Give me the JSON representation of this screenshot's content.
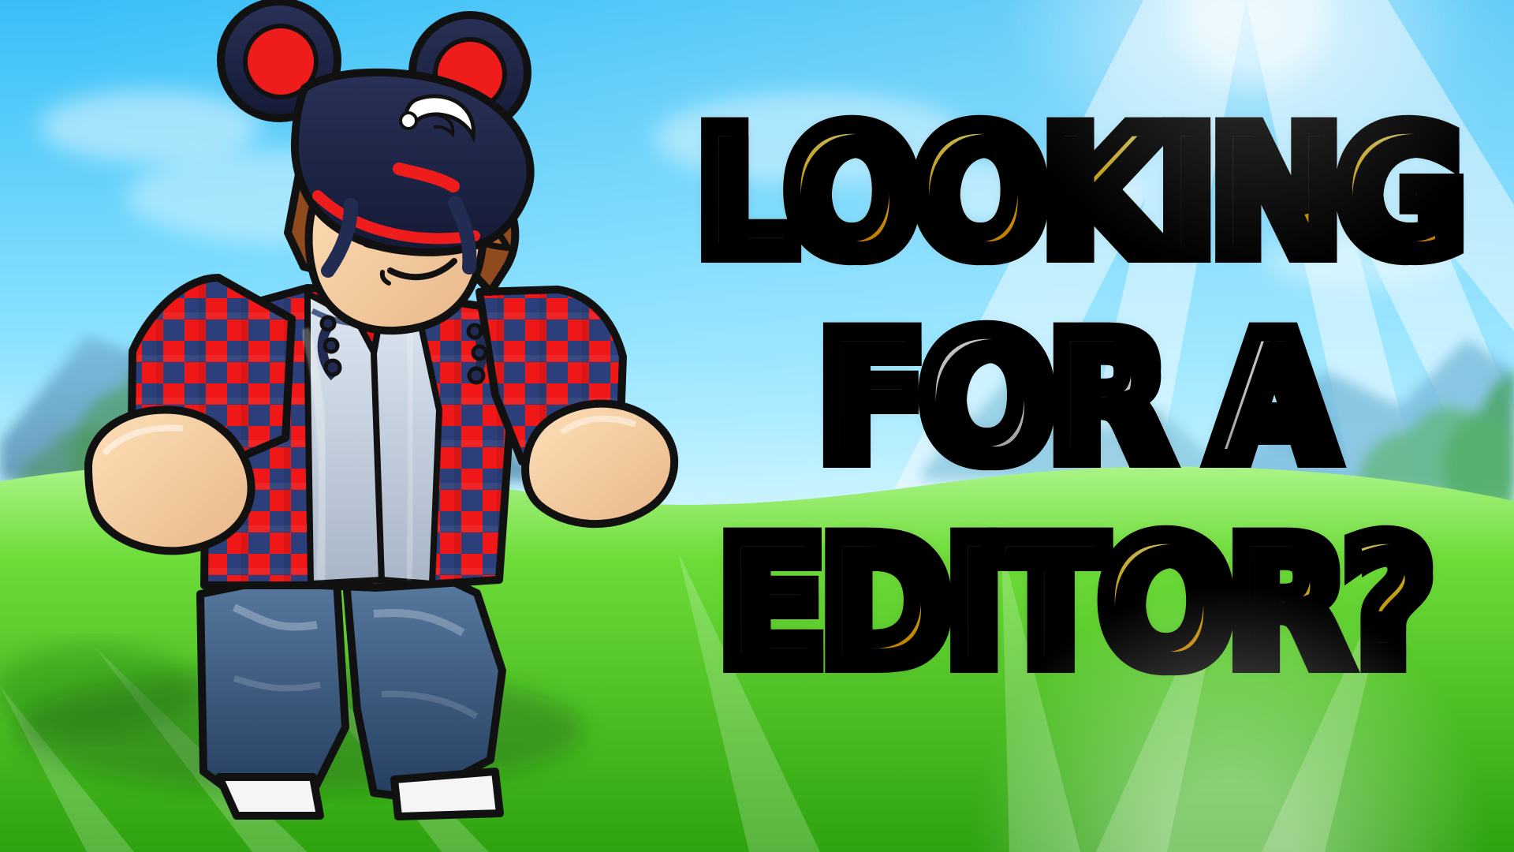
{
  "thumbnail": {
    "title_lines": [
      "LOOKING",
      "FOR A",
      "EDITOR?"
    ]
  },
  "palette": {
    "sky": "#59c8ff",
    "grass": "#44c51f",
    "title_yellow": "#ffd11e",
    "title_white": "#f4f4f4",
    "outline": "#000000",
    "shirt_red": "#e31d1d",
    "shirt_blue": "#2d3f7a",
    "hat_navy": "#1d2447",
    "hat_red": "#ef1c1c",
    "jeans_blue": "#355e8b",
    "skin": "#f4d2a6"
  },
  "icons": {
    "hat_emblem": "crescent-mark"
  }
}
